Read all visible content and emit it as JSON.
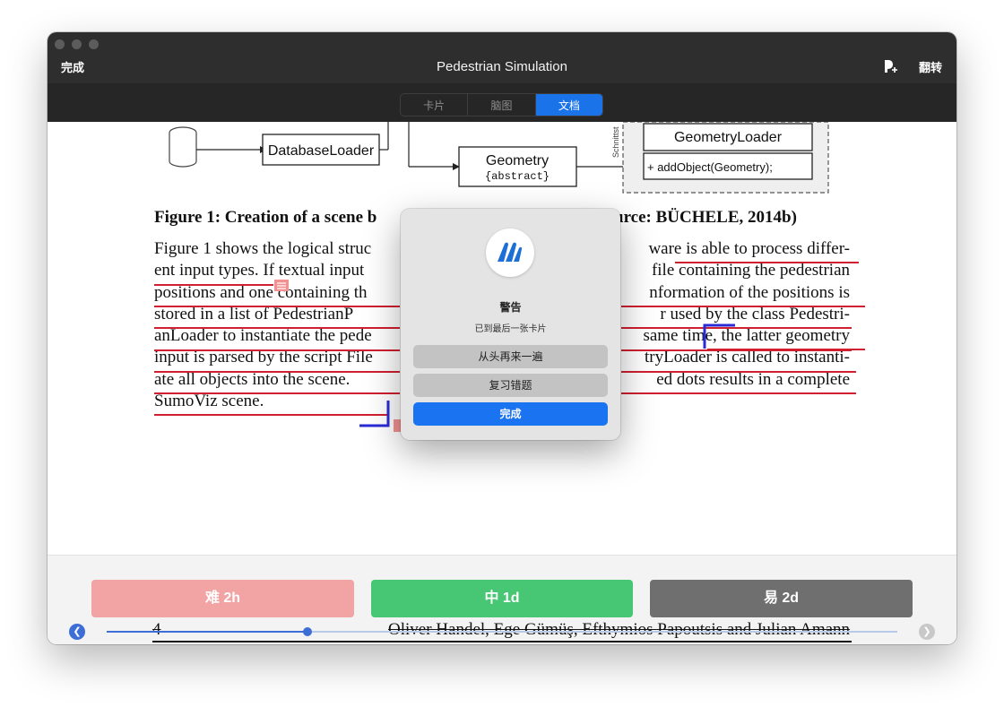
{
  "titlebar": {
    "done_label": "完成",
    "title": "Pedestrian Simulation",
    "flip_label": "翻转"
  },
  "tabs": [
    {
      "label": "卡片",
      "active": false
    },
    {
      "label": "脑图",
      "active": false
    },
    {
      "label": "文档",
      "active": true
    }
  ],
  "document": {
    "diagram": {
      "database_loader": "DatabaseLoader",
      "geometry_title": "Geometry",
      "geometry_sub": "{abstract}",
      "geometry_loader": "GeometryLoader",
      "add_object": "+ addObject(Geometry);",
      "side_label": "Schnittst"
    },
    "caption": "Figure 1: Creation of a scene b",
    "caption_right": "urce: BÜCHELE, 2014b)",
    "paragraph_lines": [
      {
        "left": "Figure 1 shows the logical struc",
        "right": "ware is able to process differ-"
      },
      {
        "left": "ent input types. If textual input",
        "right": "file containing the pedestrian"
      },
      {
        "left": "positions and one containing th",
        "right": "nformation of the positions is"
      },
      {
        "left": "stored in a list of PedestrianP",
        "right": "r used by the class Pedestri-"
      },
      {
        "left": "anLoader to instantiate the pede",
        "right": "same time, the latter geometry"
      },
      {
        "left": "input is parsed by the script File",
        "right": "tryLoader is called to instanti-"
      },
      {
        "left": "ate all objects into the scene.",
        "right": "ed dots results in a complete"
      },
      {
        "left": "SumoViz scene.",
        "right": ""
      }
    ]
  },
  "rating": {
    "hard": "难 2h",
    "medium": "中 1d",
    "easy": "易 2d"
  },
  "progress": {
    "fraction": 0.254
  },
  "footer": {
    "page_number": "4",
    "authors": "Oliver Handel, Ege Gümüş, Efthymios Papoutsis and Julian Amann"
  },
  "modal": {
    "title": "警告",
    "message": "已到最后一张卡片",
    "restart_label": "从头再来一遍",
    "review_label": "复习错题",
    "done_label": "完成"
  },
  "colors": {
    "accent": "#1a73e8",
    "hard": "#f2a3a3",
    "medium": "#47c774",
    "easy": "#6f6f6f",
    "annotation_red": "#d01f2f",
    "annotation_blue": "#2b2bd6"
  },
  "icons": {
    "app": "marginnote-logo-icon",
    "speak": "text-to-speech-icon",
    "prev": "chevron-left-icon",
    "next": "chevron-right-icon",
    "note": "note-marker-icon",
    "database": "database-cylinder-icon"
  }
}
